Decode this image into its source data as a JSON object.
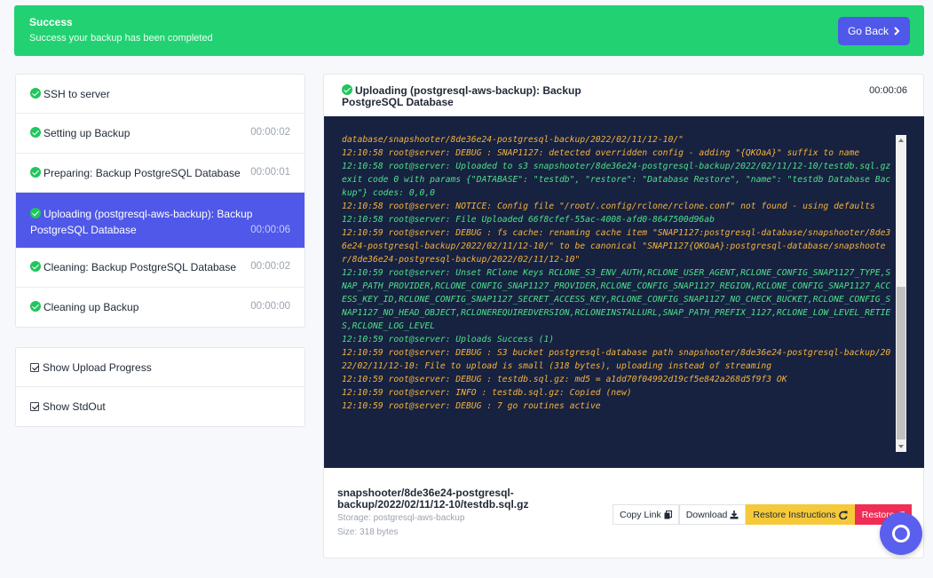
{
  "banner": {
    "title": "Success",
    "message": "Success your backup has been completed",
    "go_back_label": "Go Back"
  },
  "steps": [
    {
      "label": "SSH to server",
      "time": ""
    },
    {
      "label": "Setting up Backup",
      "time": "00:00:02"
    },
    {
      "label": "Preparing: Backup PostgreSQL Database",
      "time": "00:00:01"
    },
    {
      "label": "Uploading (postgresql-aws-backup): Backup PostgreSQL Database",
      "time": "00:00:06",
      "active": true
    },
    {
      "label": "Cleaning: Backup PostgreSQL Database",
      "time": "00:00:02"
    },
    {
      "label": "Cleaning up Backup",
      "time": "00:00:00"
    }
  ],
  "options": {
    "upload_progress": "Show Upload Progress",
    "stdout": "Show StdOut"
  },
  "panel": {
    "title": "Uploading (postgresql-aws-backup): Backup PostgreSQL Database",
    "time": "00:00:06"
  },
  "log_lines": [
    {
      "text": "database/snapshooter/8de36e24-postgresql-backup/2022/02/11/12-10/\"",
      "color": "orange"
    },
    {
      "text": "12:10:58 root@server: DEBUG : SNAP1127: detected overridden config - adding \"{QKOaA}\" suffix to name",
      "color": "orange"
    },
    {
      "text": "12:10:58 root@server: Uploaded to s3 snapshooter/8de36e24-postgresql-backup/2022/02/11/12-10/testdb.sql.gz exit code 0 with params {\"DATABASE\": \"testdb\", \"restore\": \"Database Restore\", \"name\": \"testdb Database Backup\"} codes: 0,0,0",
      "color": "green"
    },
    {
      "text": "12:10:58 root@server: NOTICE: Config file \"/root/.config/rclone/rclone.conf\" not found - using defaults",
      "color": "orange"
    },
    {
      "text": "12:10:58 root@server: File Uploaded 66f8cfef-55ac-4008-afd0-8647500d96ab",
      "color": "green"
    },
    {
      "text": "12:10:59 root@server: DEBUG : fs cache: renaming cache item \"SNAP1127:postgresql-database/snapshooter/8de36e24-postgresql-backup/2022/02/11/12-10/\" to be canonical \"SNAP1127{QKOaA}:postgresql-database/snapshooter/8de36e24-postgresql-backup/2022/02/11/12-10\"",
      "color": "orange"
    },
    {
      "text": "12:10:59 root@server: Unset RClone Keys RCLONE_S3_ENV_AUTH,RCLONE_USER_AGENT,RCLONE_CONFIG_SNAP1127_TYPE,SNAP_PATH_PROVIDER,RCLONE_CONFIG_SNAP1127_PROVIDER,RCLONE_CONFIG_SNAP1127_REGION,RCLONE_CONFIG_SNAP1127_ACCESS_KEY_ID,RCLONE_CONFIG_SNAP1127_SECRET_ACCESS_KEY,RCLONE_CONFIG_SNAP1127_NO_CHECK_BUCKET,RCLONE_CONFIG_SNAP1127_NO_HEAD_OBJECT,RCLONEREQUIREDVERSION,RCLONEINSTALLURL,SNAP_PATH_PREFIX_1127,RCLONE_LOW_LEVEL_RETIES,RCLONE_LOG_LEVEL",
      "color": "green"
    },
    {
      "text": "12:10:59 root@server: Uploads Success (1)",
      "color": "green"
    },
    {
      "text": "12:10:59 root@server: DEBUG : S3 bucket postgresql-database path snapshooter/8de36e24-postgresql-backup/2022/02/11/12-10: File to upload is small (318 bytes), uploading instead of streaming",
      "color": "orange"
    },
    {
      "text": "12:10:59 root@server: DEBUG : testdb.sql.gz: md5 = a1dd70f04992d19cf5e842a268d5f9f3 OK",
      "color": "orange"
    },
    {
      "text": "12:10:59 root@server: INFO : testdb.sql.gz: Copied (new)",
      "color": "orange"
    },
    {
      "text": "12:10:59 root@server: DEBUG : 7 go routines active",
      "color": "orange"
    }
  ],
  "file": {
    "name": "snapshooter/8de36e24-postgresql-backup/2022/02/11/12-10/testdb.sql.gz",
    "storage": "Storage: postgresql-aws-backup",
    "size": "Size: 318 bytes"
  },
  "actions": {
    "copy_link": "Copy Link",
    "download": "Download",
    "restore_instructions": "Restore Instructions",
    "restore": "Restore"
  },
  "colors": {
    "success_banner": "#22d272",
    "primary": "#4f58e8",
    "console_bg": "#172140",
    "log_orange": "#f5b43c",
    "log_green": "#4ee08b",
    "restore_instructions": "#f6c93b",
    "restore": "#f02d55"
  },
  "icons": [
    "chevron-right-icon",
    "check-circle-icon",
    "checkbox-icon",
    "copy-icon",
    "download-icon",
    "refresh-icon",
    "help-chat-icon"
  ]
}
